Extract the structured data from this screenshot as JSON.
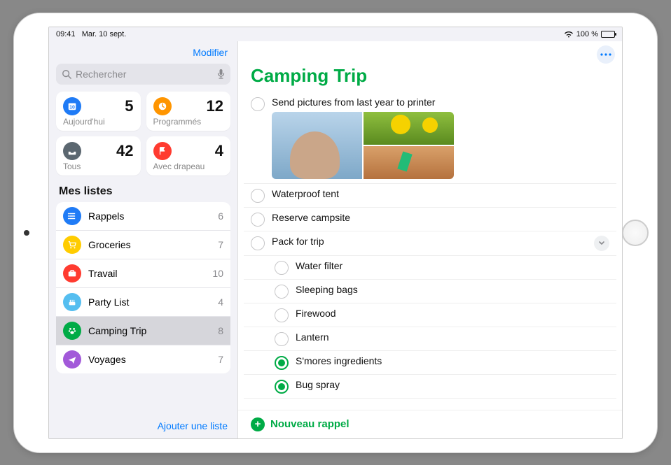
{
  "statusbar": {
    "time": "09:41",
    "date": "Mar. 10 sept.",
    "battery": "100 %"
  },
  "sidebar": {
    "edit": "Modifier",
    "search_placeholder": "Rechercher",
    "tiles": [
      {
        "label": "Aujourd'hui",
        "count": "5",
        "icon": "calendar-icon",
        "color": "#1f7bf6"
      },
      {
        "label": "Programmés",
        "count": "12",
        "icon": "clock-icon",
        "color": "#ff9500"
      },
      {
        "label": "Tous",
        "count": "42",
        "icon": "tray-icon",
        "color": "#5b6770"
      },
      {
        "label": "Avec drapeau",
        "count": "4",
        "icon": "flag-icon",
        "color": "#ff3b30"
      }
    ],
    "section_title": "Mes listes",
    "lists": [
      {
        "label": "Rappels",
        "count": "6",
        "color": "#1f7bf6",
        "icon": "list-icon"
      },
      {
        "label": "Groceries",
        "count": "7",
        "color": "#ffcc00",
        "icon": "cart-icon"
      },
      {
        "label": "Travail",
        "count": "10",
        "color": "#ff3b30",
        "icon": "briefcase-icon"
      },
      {
        "label": "Party List",
        "count": "4",
        "color": "#55bef0",
        "icon": "cake-icon"
      },
      {
        "label": "Camping Trip",
        "count": "8",
        "color": "#00ab46",
        "icon": "paw-icon",
        "selected": true
      },
      {
        "label": "Voyages",
        "count": "7",
        "color": "#a259d9",
        "icon": "plane-icon"
      }
    ],
    "add_list": "Ajouter une liste"
  },
  "main": {
    "title": "Camping Trip",
    "new_reminder": "Nouveau rappel",
    "reminders": [
      {
        "text": "Send pictures from last year to printer",
        "done": false,
        "has_attachments": true
      },
      {
        "text": "Waterproof tent",
        "done": false
      },
      {
        "text": "Reserve campsite",
        "done": false
      },
      {
        "text": "Pack for trip",
        "done": false,
        "expandable": true
      },
      {
        "text": "Water filter",
        "done": false,
        "sub": true
      },
      {
        "text": "Sleeping bags",
        "done": false,
        "sub": true
      },
      {
        "text": "Firewood",
        "done": false,
        "sub": true
      },
      {
        "text": "Lantern",
        "done": false,
        "sub": true
      },
      {
        "text": "S'mores ingredients",
        "done": true,
        "sub": true
      },
      {
        "text": "Bug spray",
        "done": true,
        "sub": true
      }
    ]
  }
}
